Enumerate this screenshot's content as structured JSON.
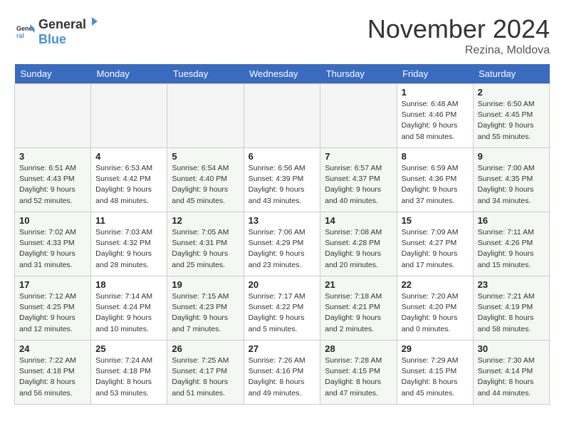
{
  "logo": {
    "line1": "General",
    "line2": "Blue"
  },
  "title": "November 2024",
  "location": "Rezina, Moldova",
  "days_of_week": [
    "Sunday",
    "Monday",
    "Tuesday",
    "Wednesday",
    "Thursday",
    "Friday",
    "Saturday"
  ],
  "weeks": [
    {
      "days": [
        {
          "num": "",
          "info": ""
        },
        {
          "num": "",
          "info": ""
        },
        {
          "num": "",
          "info": ""
        },
        {
          "num": "",
          "info": ""
        },
        {
          "num": "",
          "info": ""
        },
        {
          "num": "1",
          "info": "Sunrise: 6:48 AM\nSunset: 4:46 PM\nDaylight: 9 hours and 58 minutes."
        },
        {
          "num": "2",
          "info": "Sunrise: 6:50 AM\nSunset: 4:45 PM\nDaylight: 9 hours and 55 minutes."
        }
      ]
    },
    {
      "days": [
        {
          "num": "3",
          "info": "Sunrise: 6:51 AM\nSunset: 4:43 PM\nDaylight: 9 hours and 52 minutes."
        },
        {
          "num": "4",
          "info": "Sunrise: 6:53 AM\nSunset: 4:42 PM\nDaylight: 9 hours and 48 minutes."
        },
        {
          "num": "5",
          "info": "Sunrise: 6:54 AM\nSunset: 4:40 PM\nDaylight: 9 hours and 45 minutes."
        },
        {
          "num": "6",
          "info": "Sunrise: 6:56 AM\nSunset: 4:39 PM\nDaylight: 9 hours and 43 minutes."
        },
        {
          "num": "7",
          "info": "Sunrise: 6:57 AM\nSunset: 4:37 PM\nDaylight: 9 hours and 40 minutes."
        },
        {
          "num": "8",
          "info": "Sunrise: 6:59 AM\nSunset: 4:36 PM\nDaylight: 9 hours and 37 minutes."
        },
        {
          "num": "9",
          "info": "Sunrise: 7:00 AM\nSunset: 4:35 PM\nDaylight: 9 hours and 34 minutes."
        }
      ]
    },
    {
      "days": [
        {
          "num": "10",
          "info": "Sunrise: 7:02 AM\nSunset: 4:33 PM\nDaylight: 9 hours and 31 minutes."
        },
        {
          "num": "11",
          "info": "Sunrise: 7:03 AM\nSunset: 4:32 PM\nDaylight: 9 hours and 28 minutes."
        },
        {
          "num": "12",
          "info": "Sunrise: 7:05 AM\nSunset: 4:31 PM\nDaylight: 9 hours and 25 minutes."
        },
        {
          "num": "13",
          "info": "Sunrise: 7:06 AM\nSunset: 4:29 PM\nDaylight: 9 hours and 23 minutes."
        },
        {
          "num": "14",
          "info": "Sunrise: 7:08 AM\nSunset: 4:28 PM\nDaylight: 9 hours and 20 minutes."
        },
        {
          "num": "15",
          "info": "Sunrise: 7:09 AM\nSunset: 4:27 PM\nDaylight: 9 hours and 17 minutes."
        },
        {
          "num": "16",
          "info": "Sunrise: 7:11 AM\nSunset: 4:26 PM\nDaylight: 9 hours and 15 minutes."
        }
      ]
    },
    {
      "days": [
        {
          "num": "17",
          "info": "Sunrise: 7:12 AM\nSunset: 4:25 PM\nDaylight: 9 hours and 12 minutes."
        },
        {
          "num": "18",
          "info": "Sunrise: 7:14 AM\nSunset: 4:24 PM\nDaylight: 9 hours and 10 minutes."
        },
        {
          "num": "19",
          "info": "Sunrise: 7:15 AM\nSunset: 4:23 PM\nDaylight: 9 hours and 7 minutes."
        },
        {
          "num": "20",
          "info": "Sunrise: 7:17 AM\nSunset: 4:22 PM\nDaylight: 9 hours and 5 minutes."
        },
        {
          "num": "21",
          "info": "Sunrise: 7:18 AM\nSunset: 4:21 PM\nDaylight: 9 hours and 2 minutes."
        },
        {
          "num": "22",
          "info": "Sunrise: 7:20 AM\nSunset: 4:20 PM\nDaylight: 9 hours and 0 minutes."
        },
        {
          "num": "23",
          "info": "Sunrise: 7:21 AM\nSunset: 4:19 PM\nDaylight: 8 hours and 58 minutes."
        }
      ]
    },
    {
      "days": [
        {
          "num": "24",
          "info": "Sunrise: 7:22 AM\nSunset: 4:18 PM\nDaylight: 8 hours and 56 minutes."
        },
        {
          "num": "25",
          "info": "Sunrise: 7:24 AM\nSunset: 4:18 PM\nDaylight: 8 hours and 53 minutes."
        },
        {
          "num": "26",
          "info": "Sunrise: 7:25 AM\nSunset: 4:17 PM\nDaylight: 8 hours and 51 minutes."
        },
        {
          "num": "27",
          "info": "Sunrise: 7:26 AM\nSunset: 4:16 PM\nDaylight: 8 hours and 49 minutes."
        },
        {
          "num": "28",
          "info": "Sunrise: 7:28 AM\nSunset: 4:15 PM\nDaylight: 8 hours and 47 minutes."
        },
        {
          "num": "29",
          "info": "Sunrise: 7:29 AM\nSunset: 4:15 PM\nDaylight: 8 hours and 45 minutes."
        },
        {
          "num": "30",
          "info": "Sunrise: 7:30 AM\nSunset: 4:14 PM\nDaylight: 8 hours and 44 minutes."
        }
      ]
    }
  ]
}
